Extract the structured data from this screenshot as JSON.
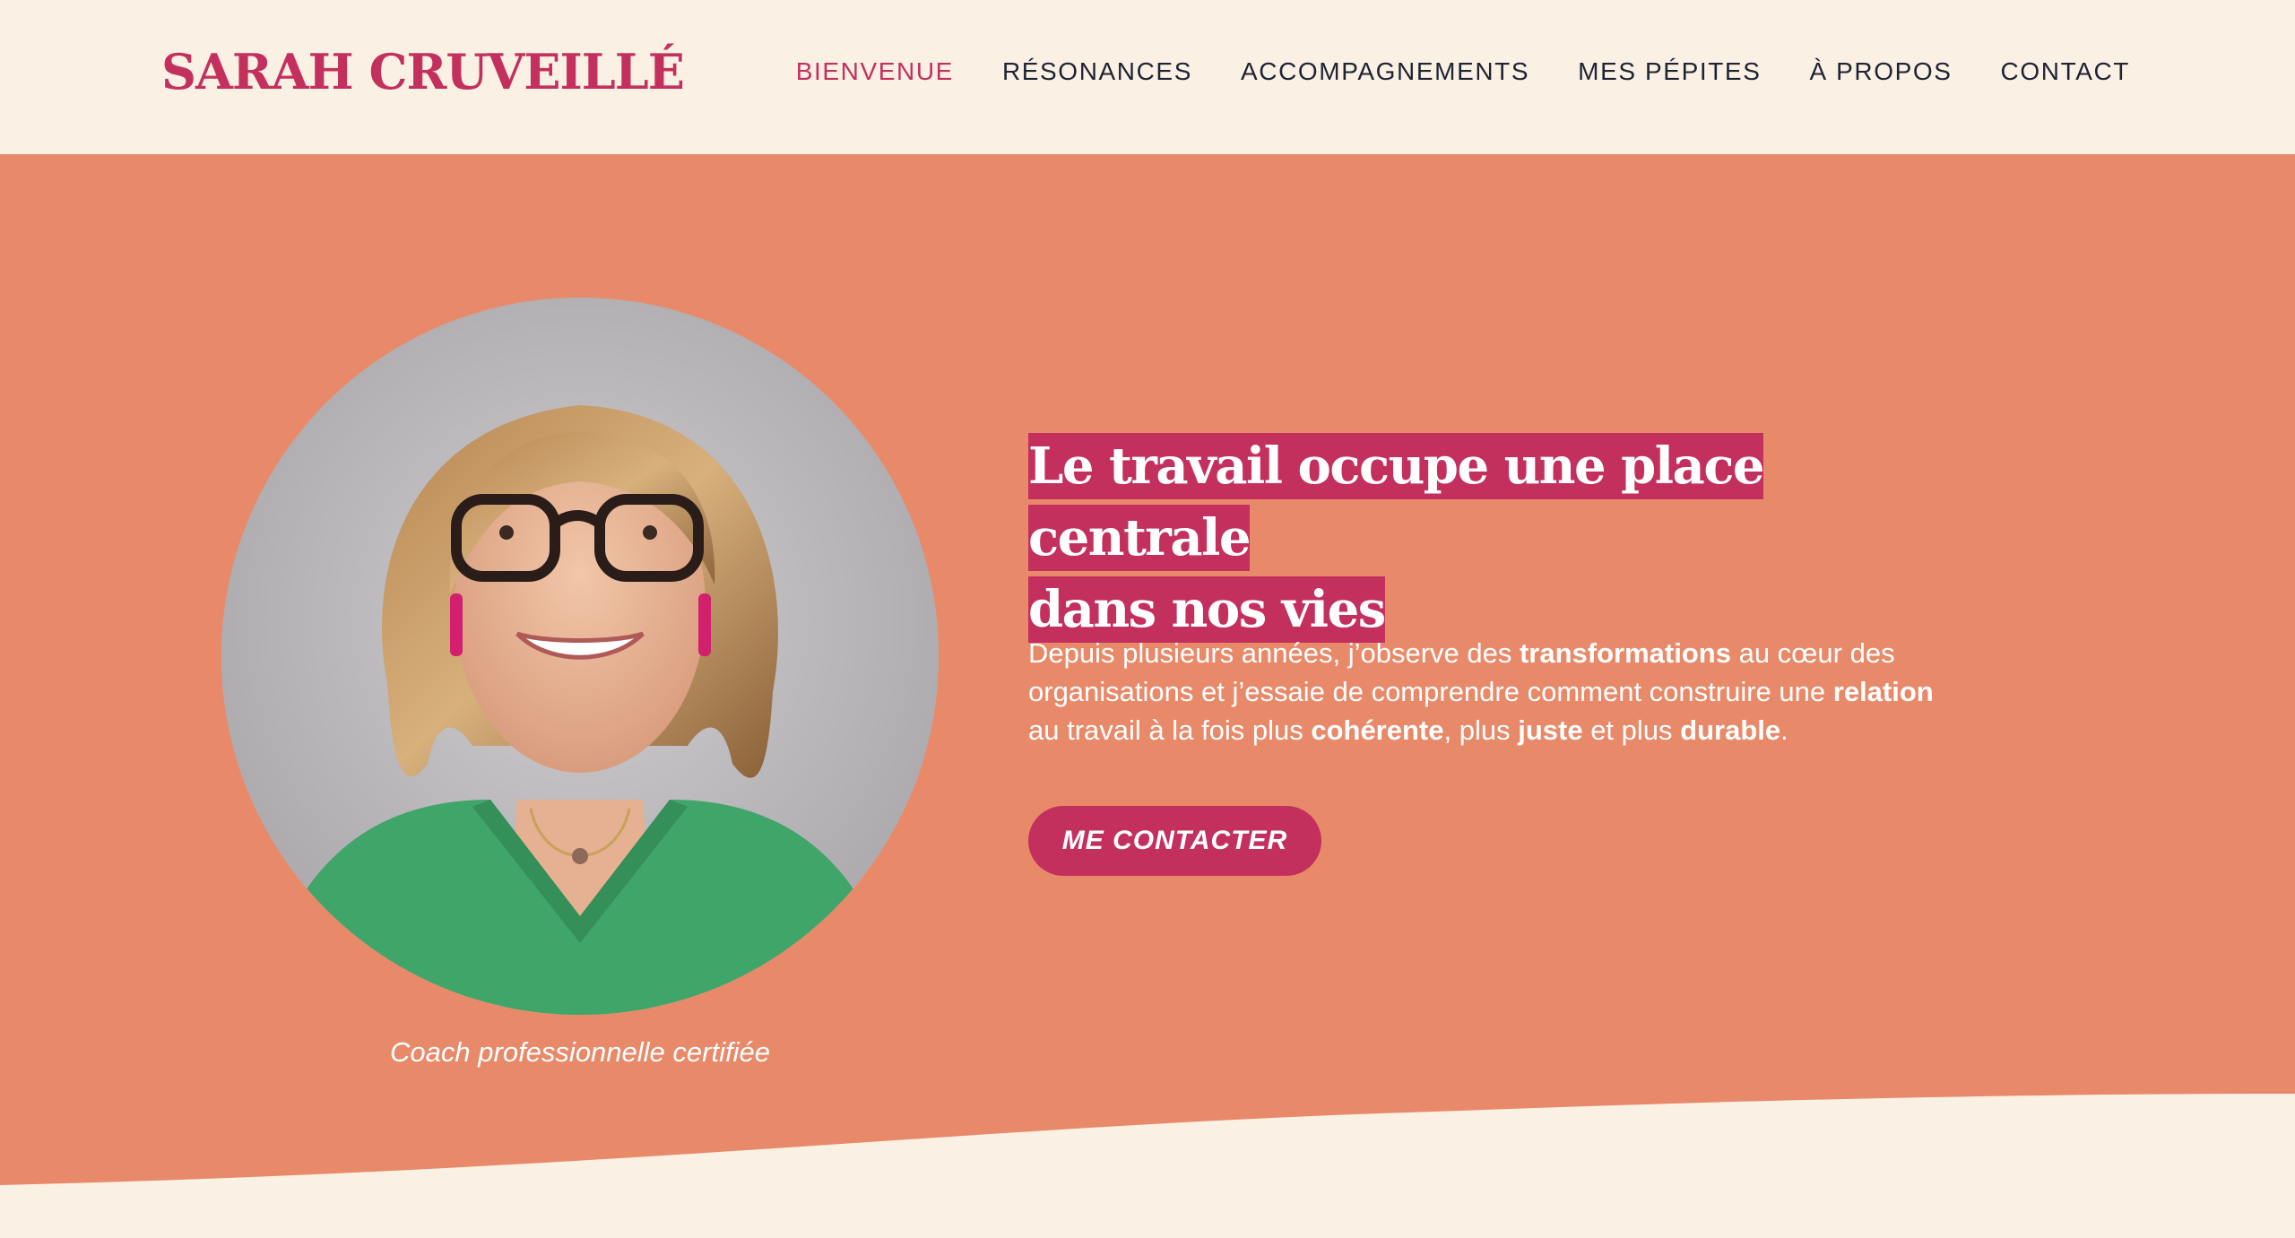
{
  "header": {
    "logo": "SARAH CRUVEILLÉ",
    "nav": [
      {
        "label": "BIENVENUE",
        "active": true
      },
      {
        "label": "RÉSONANCES",
        "active": false
      },
      {
        "label": "ACCOMPAGNEMENTS",
        "active": false
      },
      {
        "label": "MES PÉPITES",
        "active": false
      },
      {
        "label": "À PROPOS",
        "active": false
      },
      {
        "label": "CONTACT",
        "active": false
      }
    ]
  },
  "hero": {
    "headline_line1": "Le travail occupe une place centrale",
    "headline_line2": "dans nos vies",
    "intro": {
      "p1": "Depuis plusieurs années, j’observe des ",
      "b1": "transformations",
      "p2": " au cœur des organisations et j’essaie de comprendre comment construire une ",
      "b2": "relation",
      "p3": " au travail à la fois plus ",
      "b3": "cohérente",
      "p4": ", plus ",
      "b4": "juste",
      "p5": " et plus ",
      "b5": "durable",
      "p6": "."
    },
    "cta_label": "ME CONTACTER",
    "portrait_caption": "Coach professionnelle certifiée"
  },
  "colors": {
    "brand": "#c4305e",
    "hero_background": "#e88a69",
    "page_background": "#fbf0e4",
    "nav_text": "#1e2433"
  },
  "icons": {
    "portrait": "portrait-photo"
  }
}
